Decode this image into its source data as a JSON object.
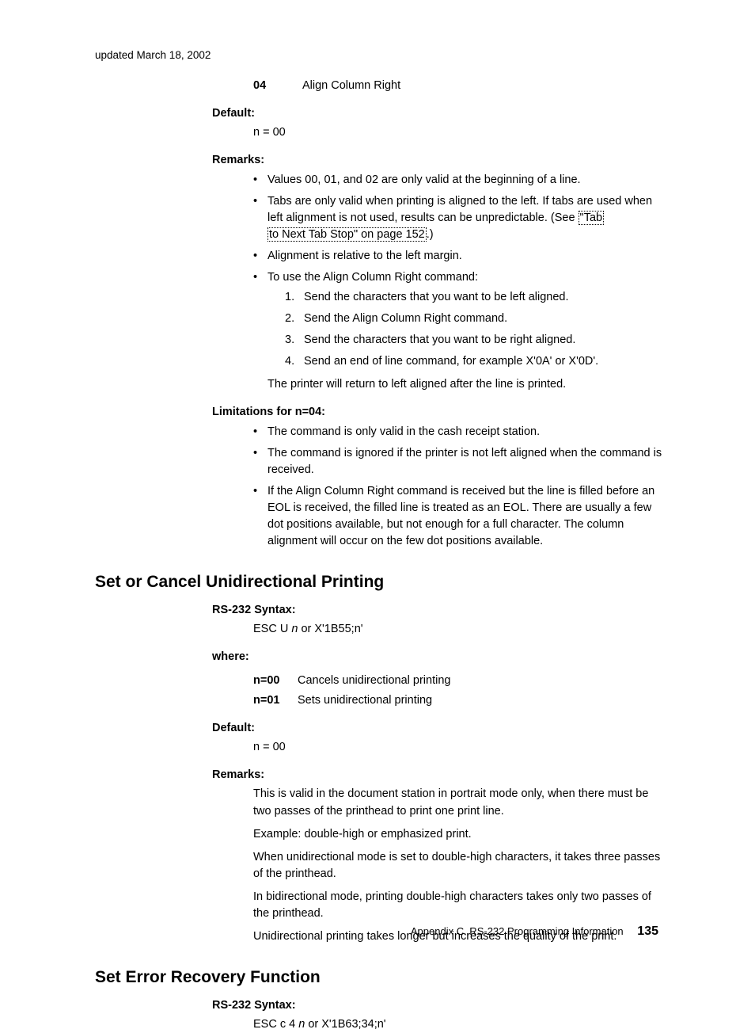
{
  "header_updated": "updated March 18, 2002",
  "top_def": {
    "code": "04",
    "text": "Align Column Right"
  },
  "labels": {
    "default": "Default:",
    "remarks": "Remarks:",
    "limitations": "Limitations for n=04:",
    "rs232": "RS-232 Syntax:",
    "where": "where:"
  },
  "default_value_1": "n = 00",
  "remarks1": {
    "b1": "Values 00, 01, and 02 are only valid at the beginning of a line.",
    "b2a": "Tabs are only valid when printing is aligned to the left. If tabs are used when left alignment is not used, results can be unpredictable. (See ",
    "b2link1": "\"Tab",
    "b2link2": "to Next Tab Stop\" on page 152",
    "b2b": ".)",
    "b3": "Alignment is relative to the left margin.",
    "b4": "To use the Align Column Right command:",
    "s1": "Send the characters that you want to be left aligned.",
    "s2": "Send the Align Column Right command.",
    "s3": "Send the characters that you want to be right aligned.",
    "s4": "Send an end of line command, for example X'0A' or X'0D'.",
    "tail": "The printer will return to left aligned after the line is printed."
  },
  "limitations": {
    "b1": "The command is only valid in the cash receipt station.",
    "b2": "The command is ignored if the printer is not left aligned when the command is received.",
    "b3": "If the Align Column Right command is received but the line is filled before an EOL is received, the filled line is treated as an EOL. There are usually a few dot positions available, but not enough for a full character. The column alignment will occur on the few dot positions available."
  },
  "section2": {
    "title": "Set or Cancel Unidirectional Printing",
    "syntax_pre": "ESC U ",
    "syntax_n": "n",
    "syntax_post": " or X'1B55;n'",
    "p1": {
      "key": "n=00",
      "text": "Cancels unidirectional printing"
    },
    "p2": {
      "key": "n=01",
      "text": "Sets unidirectional printing"
    },
    "default": "n = 00",
    "r1": "This is valid in the document station in portrait mode only, when there must be two passes of the printhead to print one print line.",
    "r2": "Example: double-high or emphasized print.",
    "r3": "When unidirectional mode is set to double-high characters, it takes three passes of the printhead.",
    "r4": "In bidirectional mode, printing double-high characters takes only two passes of the printhead.",
    "r5": "Unidirectional printing takes longer but increases the quality of the print."
  },
  "section3": {
    "title": "Set Error Recovery Function",
    "syntax_pre": "ESC c 4 ",
    "syntax_n": "n",
    "syntax_post": " or X'1B63;34;n'"
  },
  "footer": {
    "text": "Appendix C. RS-232 Programming Information",
    "page": "135"
  }
}
